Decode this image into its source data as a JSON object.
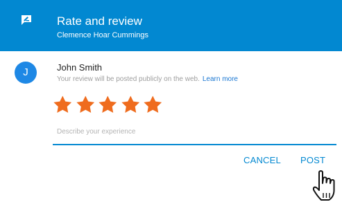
{
  "header": {
    "icon": "rate-review-icon",
    "title": "Rate and review",
    "subtitle": "Clemence Hoar Cummings",
    "background_color": "#0288d1"
  },
  "user": {
    "avatar_letter": "J",
    "avatar_color": "#1e88e5",
    "name": "John Smith",
    "notice": "Your review will be posted publicly on the web.",
    "learn_more_label": "Learn more"
  },
  "rating": {
    "value": 5,
    "max": 5,
    "star_color": "#ef6c1e"
  },
  "review": {
    "placeholder": "Describe your experience",
    "value": ""
  },
  "actions": {
    "cancel_label": "CANCEL",
    "post_label": "POST"
  },
  "pointer": {
    "icon": "hand-pointer-cursor-icon"
  }
}
